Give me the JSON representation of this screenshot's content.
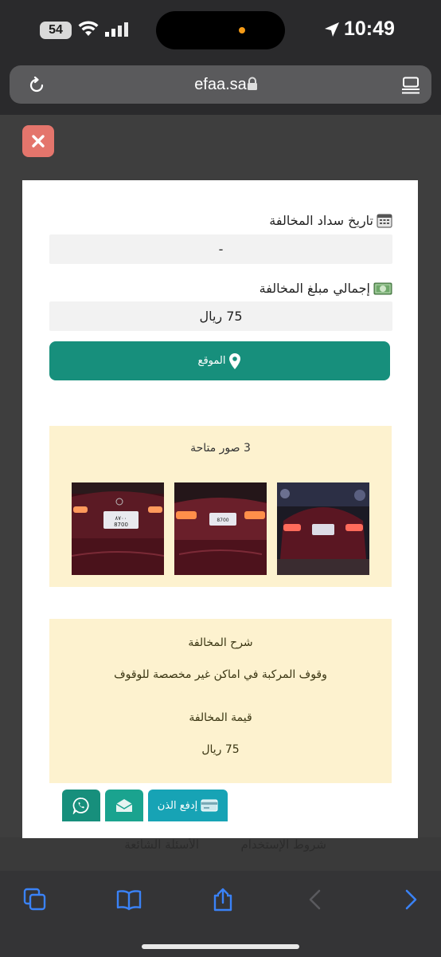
{
  "status_bar": {
    "time": "10:49",
    "battery": "54"
  },
  "browser": {
    "url": "efaa.sa"
  },
  "modal": {
    "payment_date": {
      "label": "تاريخ سداد المخالفة",
      "value": "-"
    },
    "total_amount": {
      "label": "إجمالي مبلغ المخالفة",
      "value": "75 ريال"
    },
    "location_button": "الموقع",
    "photos": {
      "title": "3 صور متاحة",
      "count": 3
    },
    "description": {
      "heading": "شرح المخالفة",
      "text": "وقوف المركبة في اماكن غير مخصصة للوقوف",
      "value_heading": "قيمة المخالفة",
      "value": "75 ريال"
    },
    "buttons": {
      "pay": "إدفع الذن"
    }
  },
  "background_links": {
    "terms": "شروط الإستخدام",
    "faq": "الأسئلة الشائعة"
  },
  "colors": {
    "primary_teal": "#178f7c",
    "pay_cyan": "#17a3b5",
    "close_red": "#e4756c",
    "panel_cream": "#fdf2cf",
    "safari_blue": "#3a82f7"
  }
}
